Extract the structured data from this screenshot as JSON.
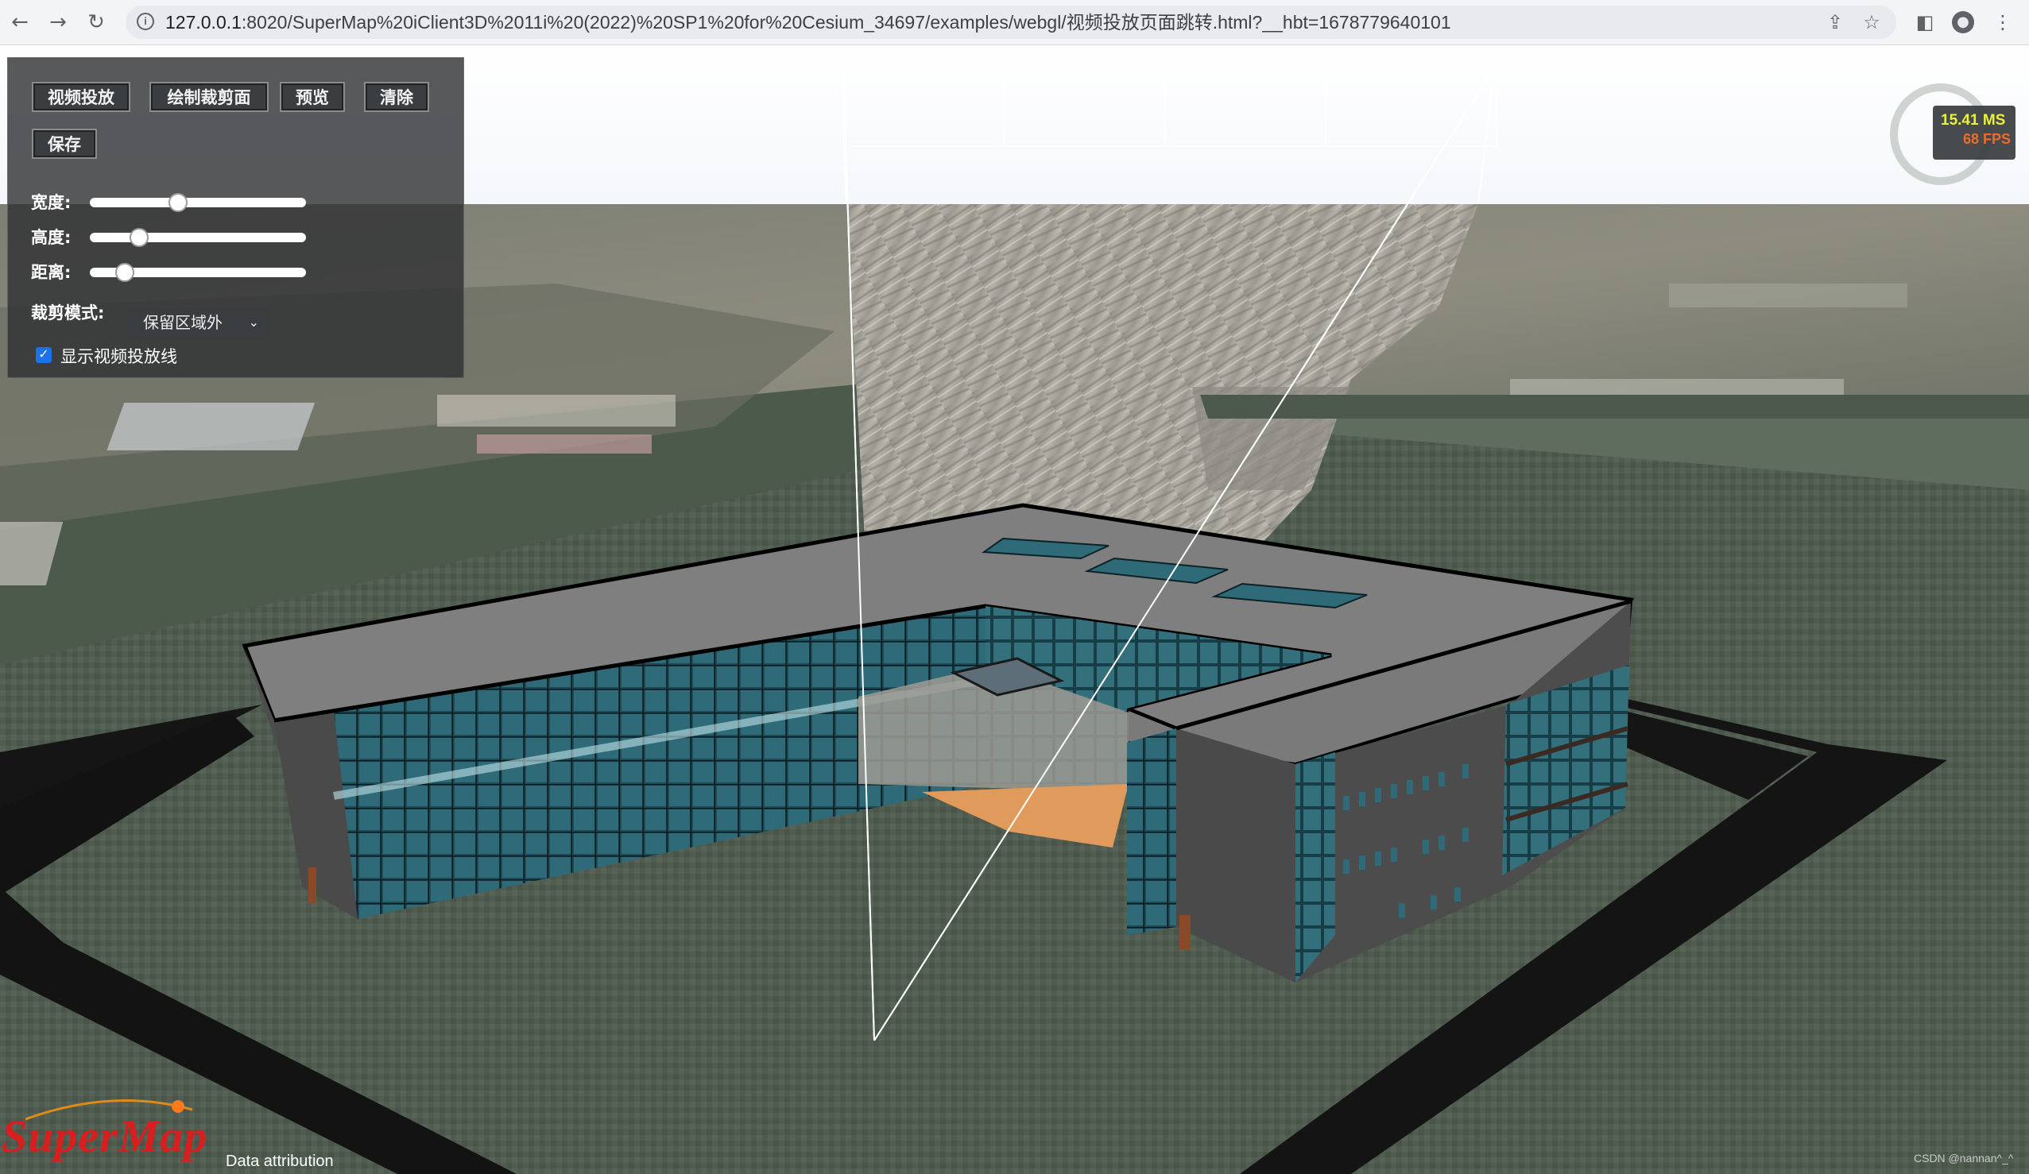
{
  "browser": {
    "url_host": "127.0.0.1",
    "url_rest": ":8020/SuperMap%20iClient3D%2011i%20(2022)%20SP1%20for%20Cesium_34697/examples/webgl/视频投放页面跳转.html?__hbt=1678779640101",
    "icons": [
      "back-arrow-icon",
      "forward-arrow-icon",
      "reload-icon",
      "info-icon",
      "share-icon",
      "star-icon",
      "side-panel-icon",
      "profile-icon",
      "menu-dots-icon"
    ]
  },
  "toolbar": {
    "video_projection_label": "视频投放",
    "draw_clip_plane_label": "绘制裁剪面",
    "preview_label": "预览",
    "clear_label": "清除",
    "save_label": "保存"
  },
  "sliders": {
    "width": {
      "label": "宽度:",
      "value_fraction": 0.4
    },
    "height": {
      "label": "高度:",
      "value_fraction": 0.2
    },
    "distance": {
      "label": "距离:",
      "value_fraction": 0.13
    }
  },
  "clip_mode": {
    "label": "裁剪模式:",
    "selected": "保留区域外"
  },
  "show_lines": {
    "label": "显示视频投放线",
    "checked": true
  },
  "perf": {
    "ms": "15.41 MS",
    "fps": "68 FPS"
  },
  "footer": {
    "logo": "SuperMap",
    "attribution": "Data attribution",
    "credit": "CSDN @nannan^_^"
  },
  "colors": {
    "accent_checkbox": "#1a73e8",
    "logo_red": "#d81f1f",
    "ms_yellow": "#e8f23c",
    "fps_orange": "#f06a2a"
  }
}
